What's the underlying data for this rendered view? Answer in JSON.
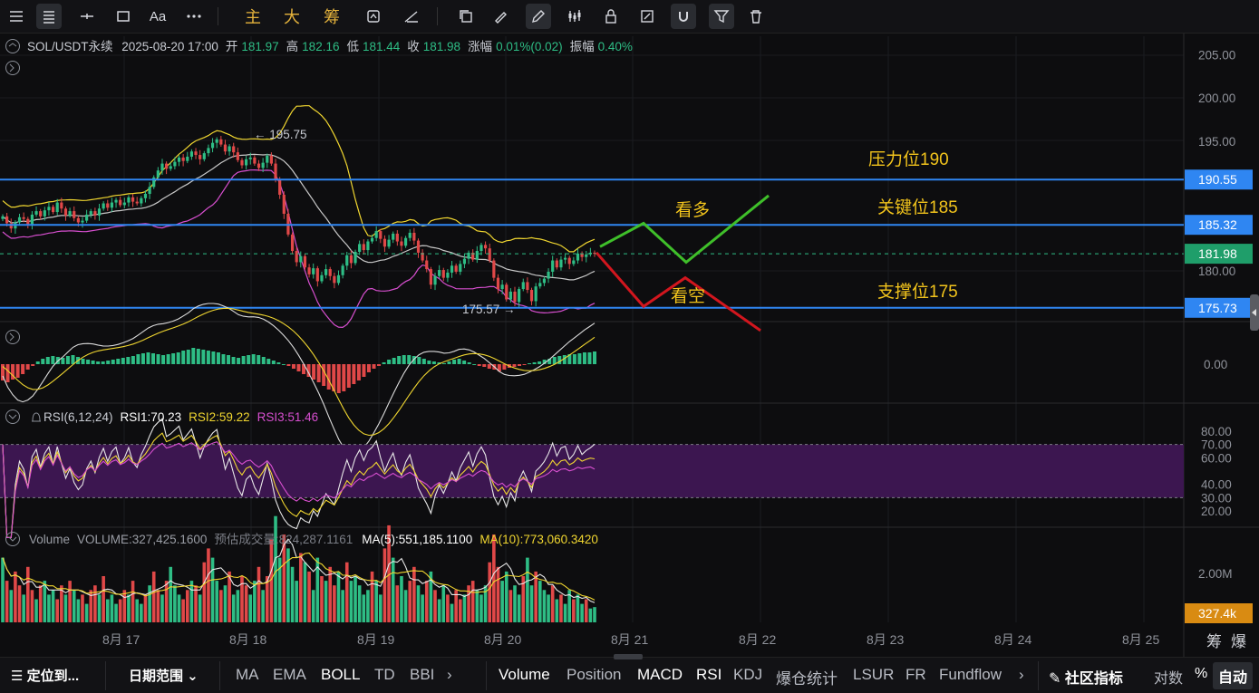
{
  "toolbar": {
    "cn_buttons": [
      "主",
      "大",
      "筹"
    ],
    "text_button": "Aa"
  },
  "header": {
    "symbol": "SOL/USDT永续",
    "datetime": "2025-08-20 17:00",
    "open_label": "开",
    "open": "181.97",
    "high_label": "高",
    "high": "182.16",
    "low_label": "低",
    "low": "181.44",
    "close_label": "收",
    "close": "181.98",
    "change_label": "涨幅",
    "change": "0.01%(0.02)",
    "amp_label": "振幅",
    "amp": "0.40%"
  },
  "rsi_legend": {
    "name": "RSI(6,12,24)",
    "rsi1": "RSI1:70.23",
    "rsi2": "RSI2:59.22",
    "rsi3": "RSI3:51.46"
  },
  "volume_legend": {
    "name": "Volume",
    "volume": "VOLUME:327,425.1600",
    "estimate": "预估成交量:824,287.1161",
    "ma5": "MA(5):551,185.1100",
    "ma10": "MA(10):773,060.3420"
  },
  "annotations": {
    "resistance": "压力位190",
    "key": "关键位185",
    "support": "支撑位175",
    "bull": "看多",
    "bear": "看空",
    "high_marker": "← 195.75",
    "low_marker": "175.57 →"
  },
  "price_tags": {
    "resistance": "190.55",
    "key": "185.32",
    "current": "181.98",
    "support": "175.73",
    "volume": "327.4k"
  },
  "corner_labels": [
    "筹",
    "爆"
  ],
  "bottombar": {
    "locate": "定位到...",
    "date_range": "日期范围",
    "main_indicators": [
      "MA",
      "EMA",
      "BOLL",
      "TD",
      "BBI"
    ],
    "sub_indicators": [
      "Volume",
      "Position",
      "MACD",
      "RSI",
      "KDJ",
      "爆仓统计",
      "LSUR",
      "FR",
      "Fundflow"
    ],
    "community": "社区指标",
    "log": "对数",
    "percent": "%",
    "auto": "自动"
  },
  "colors": {
    "up": "#2ebd85",
    "down": "#e04848",
    "boll_upper": "#f0d630",
    "boll_lower": "#d84fd0",
    "boll_mid": "#c8c8c8",
    "level_line": "#2f86f2",
    "bull_path": "#3fbf2a",
    "bear_path": "#d2161e",
    "annotation": "#f2c41c",
    "rsi_band": "#3c1650"
  },
  "chart_data": [
    {
      "type": "candlestick",
      "symbol": "SOL/USDT",
      "interval": "1h",
      "yaxis": {
        "ticks": [
          "205.00",
          "200.00",
          "195.00",
          "180.00"
        ],
        "range": [
          169,
          207
        ]
      },
      "xaxis": {
        "ticks": [
          "8月 17",
          "8月 18",
          "8月 19",
          "8月 20",
          "8月 21",
          "8月 22",
          "8月 23",
          "8月 24",
          "8月 25"
        ]
      },
      "levels": [
        {
          "label": "压力位190",
          "value": 190.55
        },
        {
          "label": "关键位185",
          "value": 185.32
        },
        {
          "label": "支撑位175",
          "value": 175.73
        }
      ],
      "current_price": 181.98,
      "marked_high": 195.75,
      "marked_low": 175.57,
      "close_series": [
        186.3,
        185.5,
        184.9,
        185.6,
        186.2,
        186.0,
        185.4,
        186.5,
        186.9,
        186.3,
        187.0,
        187.4,
        186.8,
        187.9,
        187.2,
        186.4,
        186.9,
        186.1,
        185.6,
        185.8,
        186.5,
        186.9,
        186.4,
        187.2,
        187.8,
        187.3,
        187.9,
        188.2,
        187.6,
        187.9,
        188.5,
        188.0,
        187.8,
        188.4,
        188.9,
        189.7,
        190.8,
        191.6,
        192.4,
        191.8,
        192.1,
        192.6,
        193.1,
        192.7,
        193.2,
        193.8,
        193.4,
        192.9,
        193.6,
        194.2,
        194.8,
        195.2,
        194.6,
        193.8,
        194.4,
        193.7,
        192.8,
        192.2,
        192.9,
        193.1,
        192.4,
        191.9,
        192.5,
        193.3,
        192.4,
        190.6,
        188.8,
        186.6,
        184.2,
        182.3,
        181.0,
        181.7,
        180.4,
        179.6,
        180.3,
        178.8,
        179.5,
        180.2,
        179.4,
        178.6,
        179.5,
        180.6,
        181.8,
        180.9,
        182.2,
        183.1,
        182.4,
        183.4,
        183.8,
        184.6,
        183.7,
        182.8,
        183.6,
        184.3,
        183.4,
        182.9,
        183.8,
        184.4,
        183.5,
        182.1,
        181.2,
        180.2,
        178.4,
        179.4,
        180.1,
        179.2,
        179.8,
        180.6,
        179.9,
        180.8,
        181.4,
        182.1,
        181.3,
        182.3,
        183.0,
        182.6,
        181.2,
        179.2,
        177.9,
        178.4,
        176.7,
        177.6,
        176.4,
        177.9,
        178.7,
        177.8,
        176.5,
        178.2,
        178.6,
        179.1,
        179.9,
        181.2,
        180.4,
        181.3,
        181.5,
        180.8,
        181.2,
        182.0,
        181.6,
        181.9,
        182.1,
        181.98
      ]
    },
    {
      "type": "bar",
      "name": "MACD",
      "yaxis": {
        "ticks": [
          "0.00"
        ]
      },
      "histogram": [
        -1.8,
        -2.0,
        -1.7,
        -1.5,
        -1.1,
        -0.6,
        -0.2,
        0.3,
        0.6,
        0.8,
        0.9,
        0.8,
        0.7,
        0.9,
        1.0,
        0.8,
        0.6,
        0.5,
        0.4,
        0.3,
        0.3,
        0.4,
        0.5,
        0.6,
        0.7,
        0.8,
        0.9,
        1.1,
        1.2,
        1.3,
        1.2,
        1.1,
        1.0,
        1.1,
        1.2,
        1.3,
        1.5,
        1.6,
        1.8,
        1.7,
        1.6,
        1.5,
        1.4,
        1.3,
        1.1,
        1.0,
        0.8,
        0.7,
        0.9,
        1.0,
        1.1,
        1.0,
        0.8,
        0.6,
        0.4,
        0.2,
        0.0,
        -0.2,
        -0.5,
        -0.8,
        -1.1,
        -1.4,
        -1.7,
        -2.0,
        -2.4,
        -2.8,
        -3.0,
        -3.2,
        -3.0,
        -2.6,
        -2.2,
        -1.8,
        -1.4,
        -0.9,
        -0.5,
        -0.2,
        0.2,
        0.5,
        0.7,
        0.9,
        1.0,
        1.0,
        0.9,
        0.8,
        0.6,
        0.4,
        0.3,
        0.2,
        0.1,
        0.3,
        0.5,
        0.6,
        0.4,
        0.2,
        0.0,
        -0.2,
        -0.3,
        -0.5,
        -0.6,
        -0.8,
        -0.6,
        -0.4,
        -0.3,
        -0.2,
        -0.1,
        0.1,
        0.2,
        0.3,
        0.5,
        0.6,
        0.8,
        0.9,
        1.0,
        1.1,
        1.1,
        1.2,
        1.3,
        1.3,
        1.4
      ]
    },
    {
      "type": "line",
      "name": "RSI(6,12,24)",
      "yaxis": {
        "ticks": [
          "80.00",
          "70.00",
          "60.00",
          "40.00",
          "30.00",
          "20.00"
        ],
        "range": [
          15,
          85
        ]
      },
      "series": [
        {
          "name": "RSI1",
          "value": 70.23
        },
        {
          "name": "RSI2",
          "value": 59.22
        },
        {
          "name": "RSI3",
          "value": 51.46
        }
      ],
      "overbought": 70,
      "oversold": 30
    },
    {
      "type": "bar",
      "name": "Volume",
      "yaxis": {
        "ticks": [
          "2.00M"
        ],
        "range": [
          0,
          2800000
        ]
      },
      "values": [
        1.4,
        0.9,
        0.7,
        1.1,
        0.8,
        0.6,
        1.2,
        0.7,
        0.5,
        0.8,
        0.9,
        0.6,
        0.7,
        0.5,
        0.8,
        0.6,
        0.9,
        0.7,
        0.5,
        0.6,
        0.4,
        0.7,
        0.8,
        0.6,
        1.0,
        0.5,
        0.6,
        0.4,
        0.5,
        0.7,
        0.6,
        0.9,
        0.5,
        0.4,
        0.6,
        0.8,
        1.1,
        0.7,
        0.6,
        0.9,
        1.2,
        0.8,
        0.6,
        0.5,
        0.7,
        0.9,
        0.8,
        0.6,
        1.3,
        1.6,
        1.4,
        0.9,
        0.7,
        0.8,
        1.1,
        0.6,
        0.7,
        1.0,
        0.8,
        0.6,
        0.9,
        1.2,
        0.7,
        1.0,
        1.8,
        2.3,
        1.4,
        1.9,
        1.6,
        1.2,
        0.9,
        1.5,
        1.3,
        1.1,
        0.7,
        1.4,
        1.0,
        0.9,
        1.2,
        0.8,
        1.1,
        0.7,
        1.3,
        0.9,
        1.0,
        0.8,
        0.6,
        0.7,
        1.1,
        0.9,
        0.6,
        1.6,
        2.1,
        1.4,
        0.8,
        1.0,
        0.7,
        0.9,
        1.2,
        0.8,
        0.6,
        0.9,
        1.1,
        0.7,
        0.5,
        0.8,
        0.6,
        0.4,
        0.7,
        0.5,
        0.6,
        0.8,
        0.9,
        0.7,
        0.6,
        0.8,
        1.3,
        1.9,
        1.2,
        0.9,
        1.1,
        0.7,
        0.8,
        0.6,
        1.0,
        1.4,
        0.8,
        1.1,
        0.9,
        0.7,
        0.6,
        0.8,
        0.5,
        0.6,
        0.4,
        0.7,
        0.5,
        0.6,
        0.4,
        0.5,
        0.3,
        0.33
      ],
      "unit": "M"
    }
  ]
}
